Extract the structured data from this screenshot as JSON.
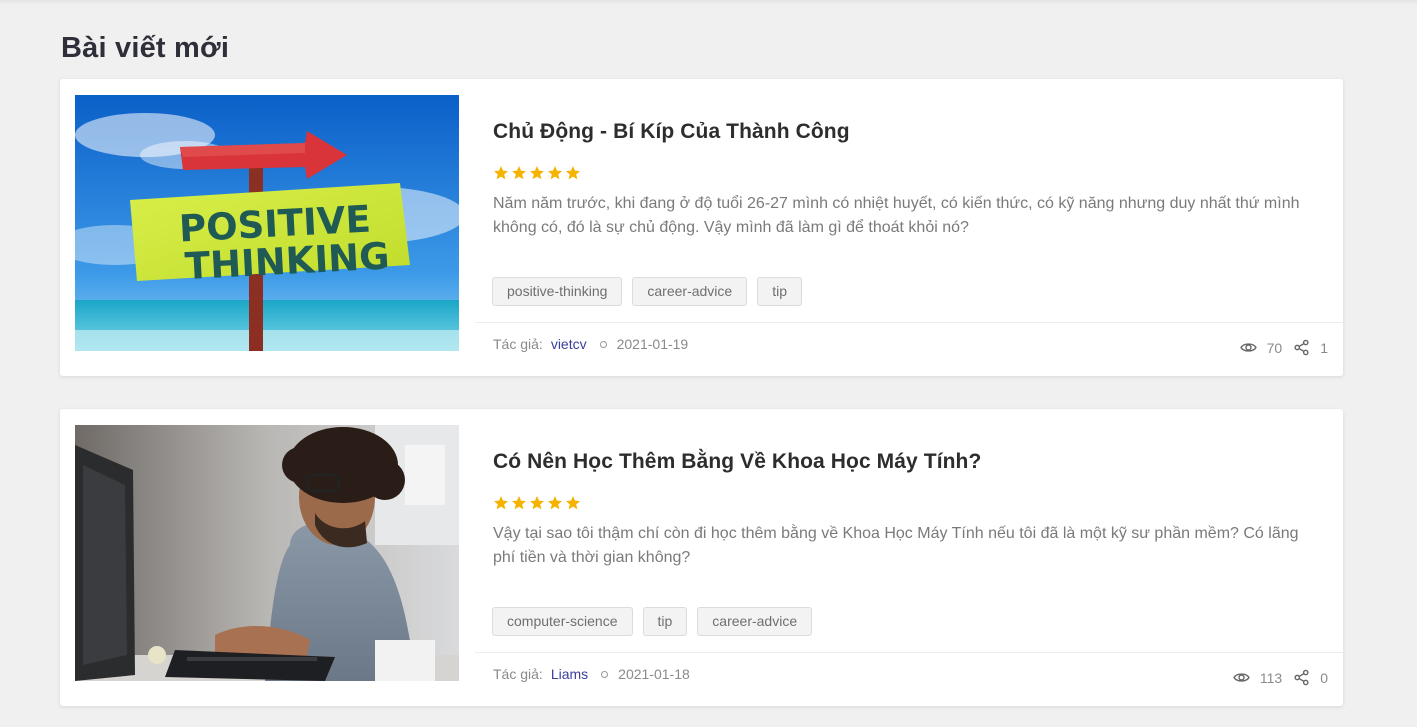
{
  "section": {
    "title": "Bài viết mới"
  },
  "posts": [
    {
      "title": "Chủ Động - Bí Kíp Của Thành Công",
      "rating": 5,
      "excerpt": "Năm năm trước, khi đang ở độ tuổi 26-27 mình có nhiệt huyết, có kiến thức, có kỹ năng nhưng duy nhất thứ mình không có, đó là sự chủ động. Vậy mình đã làm gì để thoát khỏi nó?",
      "image_text_line1": "POSITIVE",
      "image_text_line2": "THINKING",
      "tags": [
        "positive-thinking",
        "career-advice",
        "tip"
      ],
      "author_label": "Tác giả:",
      "author": "vietcv",
      "date": "2021-01-19",
      "views": "70",
      "shares": "1"
    },
    {
      "title": "Có Nên Học Thêm Bằng Về Khoa Học Máy Tính?",
      "rating": 5,
      "excerpt": "Vậy tại sao tôi thậm chí còn đi học thêm bằng về Khoa Học Máy Tính nếu tôi đã là một kỹ sư phần mềm? Có lãng phí tiền và thời gian không?",
      "tags": [
        "computer-science",
        "tip",
        "career-advice"
      ],
      "author_label": "Tác giả:",
      "author": "Liams",
      "date": "2021-01-18",
      "views": "113",
      "shares": "0"
    }
  ],
  "colors": {
    "star": "#f5b300",
    "author_link": "#3b3f9c",
    "background": "#f0f0f0"
  }
}
